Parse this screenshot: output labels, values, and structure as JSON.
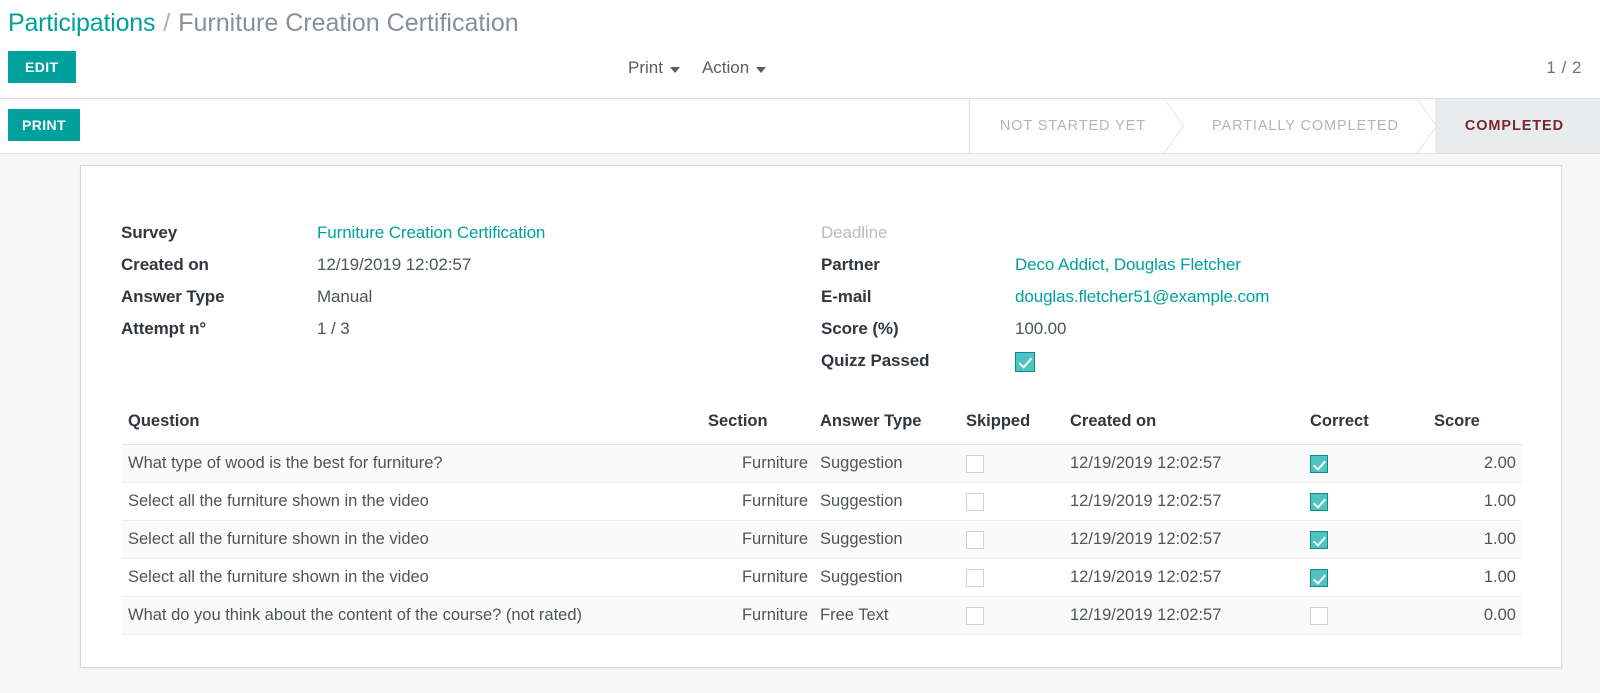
{
  "breadcrumb": {
    "root": "Participations",
    "separator": "/",
    "current": "Furniture Creation Certification"
  },
  "control_panel": {
    "edit_label": "EDIT",
    "print_label": "PRINT",
    "print_dropdown": "Print",
    "action_dropdown": "Action",
    "pager": "1 / 2"
  },
  "statusbar": {
    "stages": [
      {
        "label": "NOT STARTED YET",
        "active": false
      },
      {
        "label": "PARTIALLY COMPLETED",
        "active": false
      },
      {
        "label": "COMPLETED",
        "active": true
      }
    ]
  },
  "form": {
    "left": [
      {
        "label": "Survey",
        "value": "Furniture Creation Certification",
        "link": true
      },
      {
        "label": "Created on",
        "value": "12/19/2019 12:02:57",
        "link": false
      },
      {
        "label": "Answer Type",
        "value": "Manual",
        "link": false
      },
      {
        "label": "Attempt n°",
        "value": "1 / 3",
        "link": false
      }
    ],
    "right": [
      {
        "label": "Deadline",
        "value": "",
        "link": false,
        "empty_label": true
      },
      {
        "label": "Partner",
        "value": "Deco Addict, Douglas Fletcher",
        "link": true
      },
      {
        "label": "E-mail",
        "value": "douglas.fletcher51@example.com",
        "link": true
      },
      {
        "label": "Score (%)",
        "value": "100.00",
        "link": false
      }
    ],
    "quizz_passed": {
      "label": "Quizz Passed",
      "checked": true
    }
  },
  "table": {
    "headers": [
      "Question",
      "Section",
      "Answer Type",
      "Skipped",
      "Created on",
      "Correct",
      "Score"
    ],
    "rows": [
      {
        "question": "What type of wood is the best for furniture?",
        "section": "Furniture",
        "answer_type": "Suggestion",
        "skipped": false,
        "created_on": "12/19/2019 12:02:57",
        "correct": true,
        "score": "2.00"
      },
      {
        "question": "Select all the furniture shown in the video",
        "section": "Furniture",
        "answer_type": "Suggestion",
        "skipped": false,
        "created_on": "12/19/2019 12:02:57",
        "correct": true,
        "score": "1.00"
      },
      {
        "question": "Select all the furniture shown in the video",
        "section": "Furniture",
        "answer_type": "Suggestion",
        "skipped": false,
        "created_on": "12/19/2019 12:02:57",
        "correct": true,
        "score": "1.00"
      },
      {
        "question": "Select all the furniture shown in the video",
        "section": "Furniture",
        "answer_type": "Suggestion",
        "skipped": false,
        "created_on": "12/19/2019 12:02:57",
        "correct": true,
        "score": "1.00"
      },
      {
        "question": "What do you think about the content of the course? (not rated)",
        "section": "Furniture",
        "answer_type": "Free Text",
        "skipped": false,
        "created_on": "12/19/2019 12:02:57",
        "correct": false,
        "score": "0.00"
      }
    ]
  },
  "colors": {
    "accent": "#00A09D",
    "checkbox_fill": "#4fc3c0",
    "status_active_bg": "#e9ecef",
    "status_active_text": "#7a2730",
    "page_bg": "#f7f7f7"
  }
}
